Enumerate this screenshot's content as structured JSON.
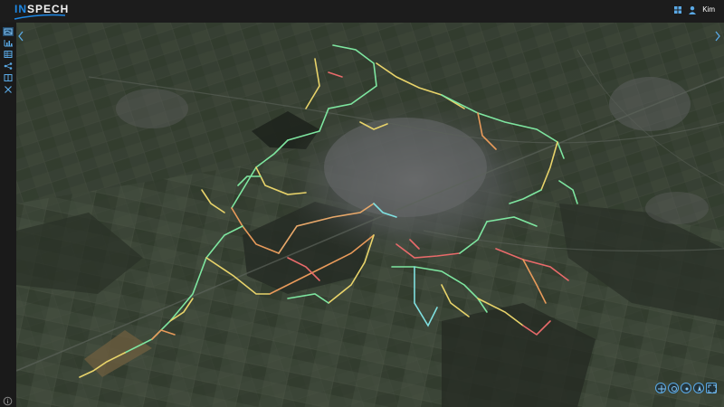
{
  "app": {
    "logo_part_1": "IN",
    "logo_part_2": "SPECH"
  },
  "header": {
    "user_name": "Kim",
    "icons": [
      "grid-icon",
      "user-icon"
    ]
  },
  "sidebar": {
    "items": [
      {
        "name": "map-view-icon",
        "active": true
      },
      {
        "name": "chart-icon",
        "active": false
      },
      {
        "name": "table-icon",
        "active": false
      },
      {
        "name": "network-icon",
        "active": false
      },
      {
        "name": "compare-icon",
        "active": false
      },
      {
        "name": "tools-icon",
        "active": false
      }
    ],
    "bottom": "info-icon"
  },
  "map_controls": [
    "move-icon",
    "compass-icon",
    "globe-icon",
    "north-icon",
    "fullscreen-icon"
  ],
  "colors": {
    "accent": "#1e88e5",
    "route_green": "#7ee6a0",
    "route_yellow": "#e8d36a",
    "route_orange": "#e89a5a",
    "route_red": "#e86a6a",
    "route_cyan": "#7fe0e0"
  }
}
